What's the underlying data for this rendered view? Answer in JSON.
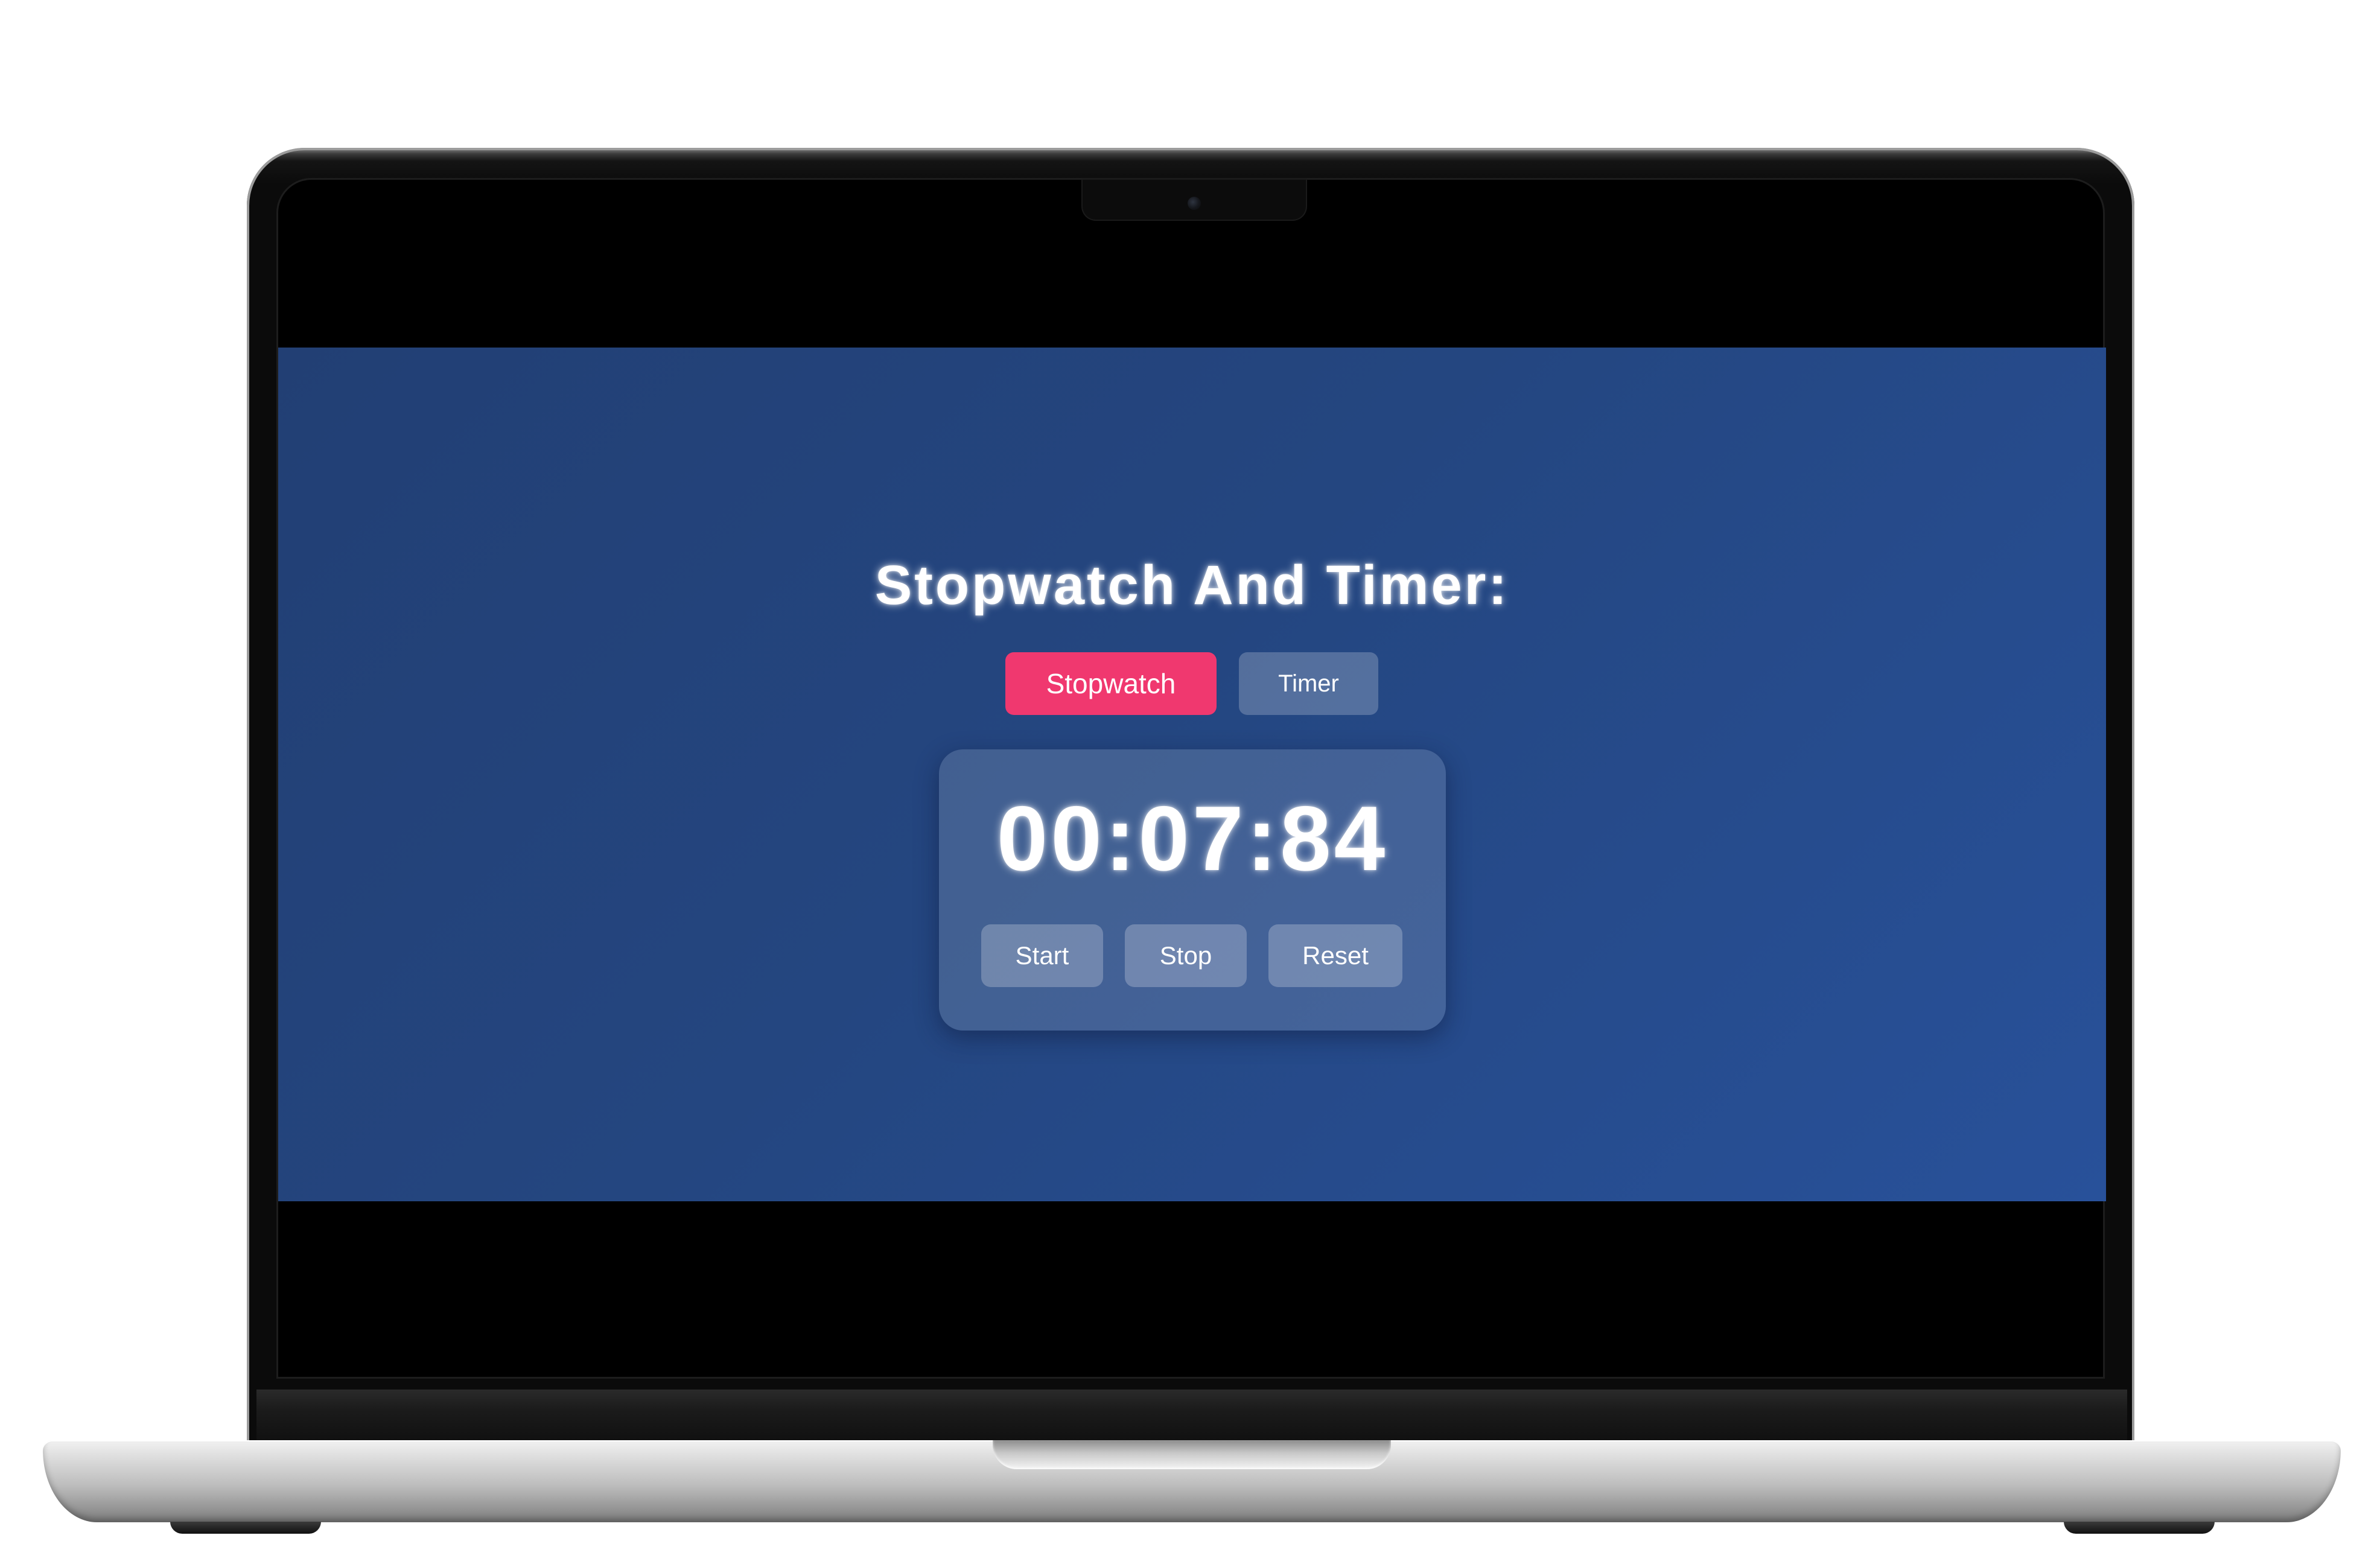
{
  "page": {
    "title": "Stopwatch And Timer:"
  },
  "tabs": {
    "stopwatch": "Stopwatch",
    "timer": "Timer",
    "active": "Stopwatch"
  },
  "stopwatch": {
    "display": "00:07:84",
    "controls": {
      "start": "Start",
      "stop": "Stop",
      "reset": "Reset"
    }
  },
  "colors": {
    "background": "#244680",
    "accent": "#f0386f",
    "text": "#ffffff"
  },
  "icons": {
    "camera": "camera-icon"
  }
}
